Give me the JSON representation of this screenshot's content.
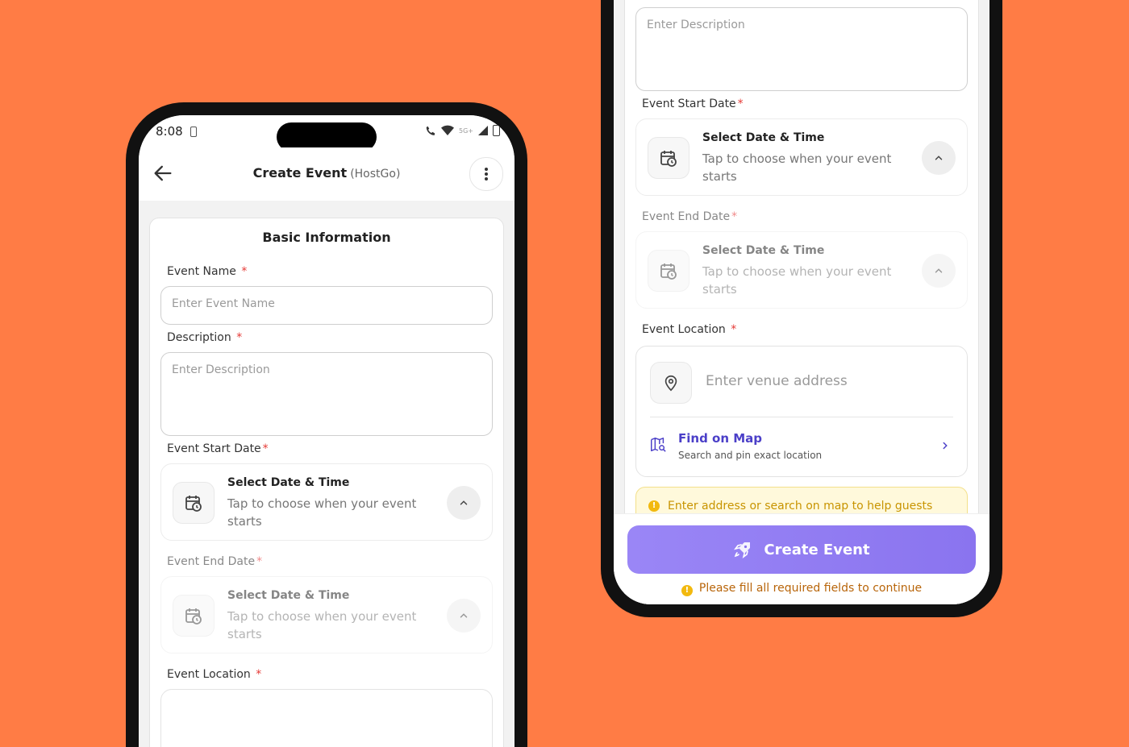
{
  "status_bar": {
    "time": "8:08",
    "network": "5G+"
  },
  "app_bar": {
    "title": "Create Event",
    "subtitle": "(HostGo)"
  },
  "form": {
    "section_title": "Basic Information",
    "event_name": {
      "label": "Event Name",
      "required": "*",
      "placeholder": "Enter Event Name"
    },
    "description": {
      "label": "Description",
      "required": "*",
      "placeholder": "Enter Description"
    },
    "start_date": {
      "label": "Event Start Date",
      "required": "*",
      "title": "Select Date & Time",
      "hint": "Tap to choose when your event starts"
    },
    "end_date": {
      "label": "Event End Date",
      "required": "*",
      "title": "Select Date & Time",
      "hint": "Tap to choose when your event starts"
    },
    "location": {
      "label": "Event Location",
      "required": "*",
      "placeholder": "Enter venue address",
      "map_title": "Find on Map",
      "map_subtitle": "Search and pin exact location",
      "warning": "Enter address or search on map to help guests"
    }
  },
  "footer": {
    "create_label": "Create Event",
    "note": "Please fill all required fields to continue",
    "warn_glyph": "!"
  },
  "colors": {
    "background": "#FF7C45",
    "accent": "#8A74EF",
    "required": "#E53935",
    "link": "#4B3FC8"
  }
}
